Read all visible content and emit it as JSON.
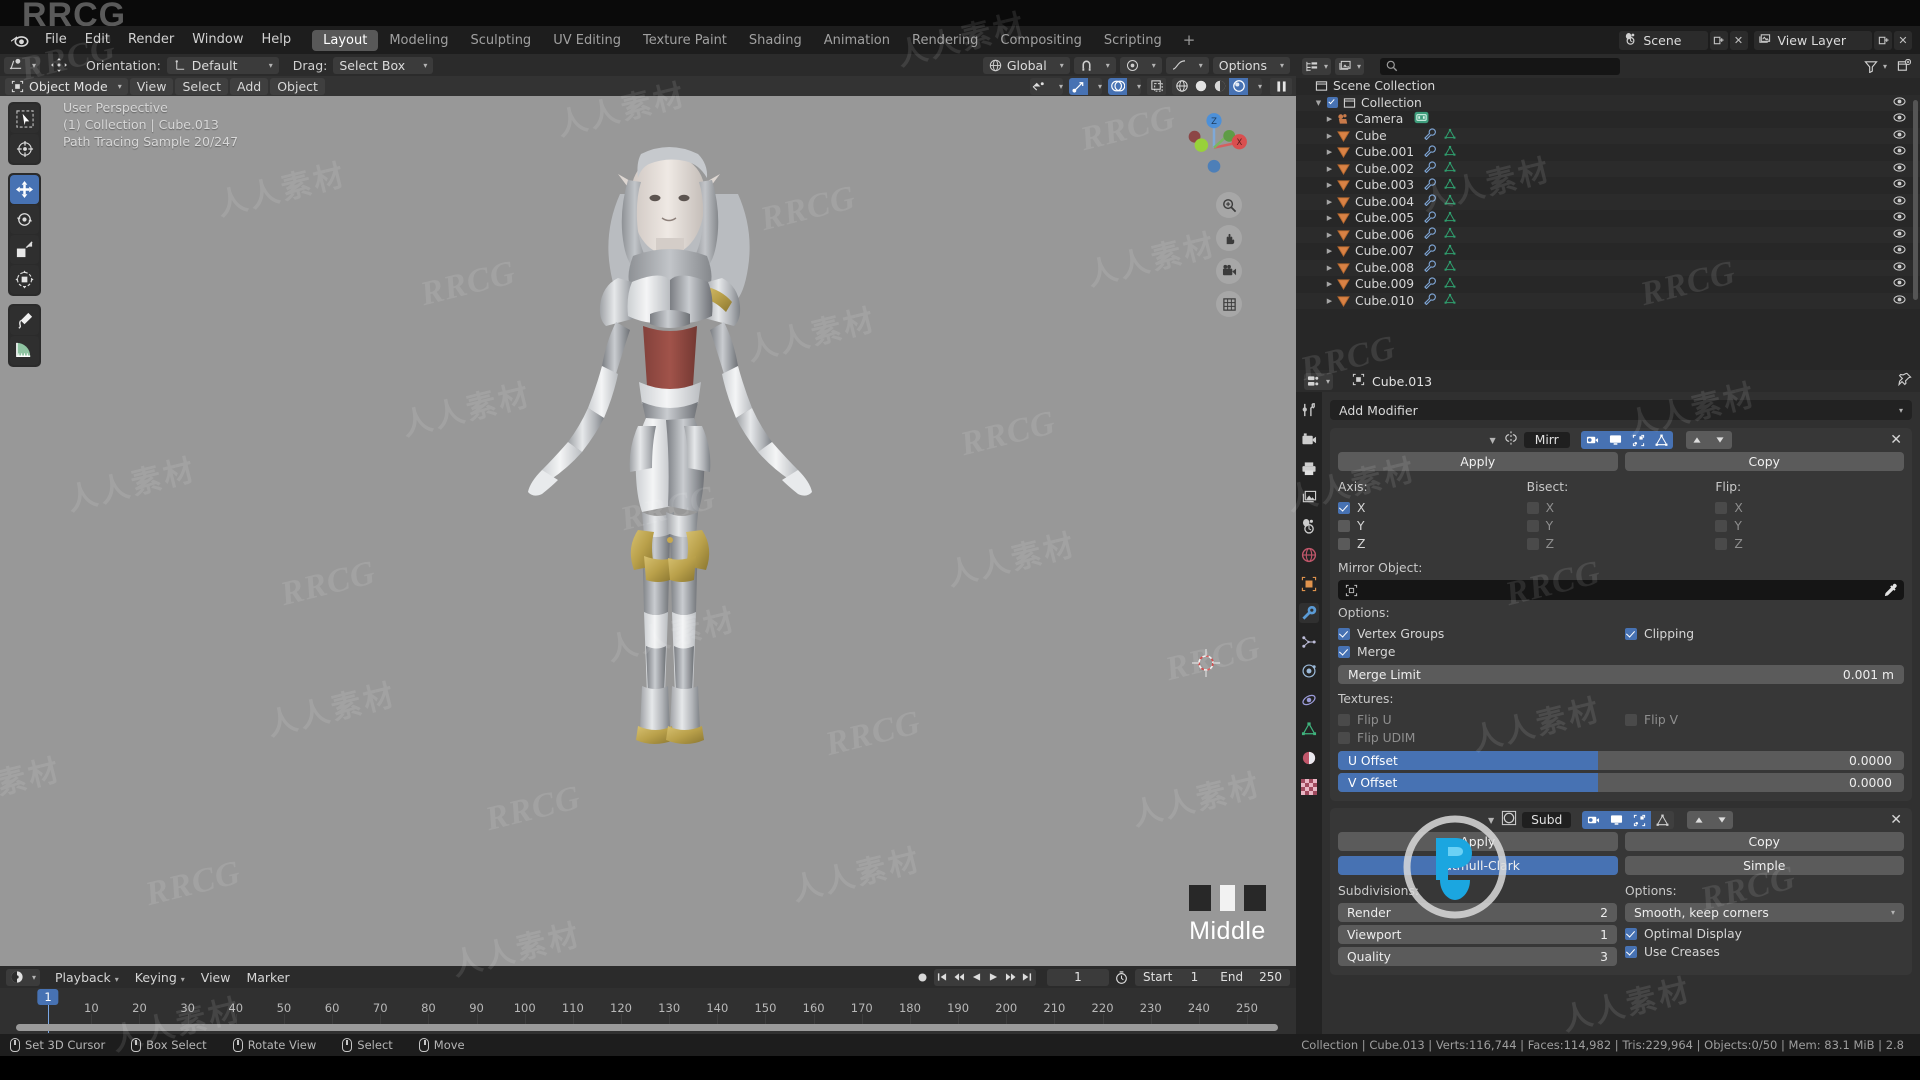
{
  "brand": {
    "watermark_en": "RRCG",
    "watermark_cn": "人人素材",
    "logo_text": "RRCG"
  },
  "topbar": {
    "menus": [
      "File",
      "Edit",
      "Render",
      "Window",
      "Help"
    ],
    "workspaces": [
      "Layout",
      "Modeling",
      "Sculpting",
      "UV Editing",
      "Texture Paint",
      "Shading",
      "Animation",
      "Rendering",
      "Compositing",
      "Scripting"
    ],
    "active_workspace": "Layout",
    "add_workspace": "+",
    "scene_name": "Scene",
    "view_layer_name": "View Layer",
    "scene_icon": "scene-icon",
    "viewlayer_icon": "images-icon"
  },
  "viewport_header": {
    "transform_pivot_icon": "pivot-icon",
    "snap_icon": "snap-magnet-icon",
    "orientation_label": "Orientation:",
    "orientation_value": "Default",
    "drag_label": "Drag:",
    "drag_value": "Select Box",
    "global_label": "Global",
    "snapping_icon": "magnet-icon",
    "proportional_icon": "proportional-edit-icon",
    "falloff_icon": "falloff-curve-icon",
    "options_label": "Options"
  },
  "mode_bar": {
    "mode": "Object Mode",
    "menus": [
      "View",
      "Select",
      "Add",
      "Object"
    ],
    "right_toggles": [
      "visibility-icon",
      "gizmo-icon",
      "overlays-icon",
      "xray-icon",
      "wireframe-shading",
      "solid-shading",
      "material-preview-shading",
      "rendered-shading",
      "pause-render-icon"
    ]
  },
  "viewport": {
    "overlay_lines": [
      "User Perspective",
      "(1) Collection | Cube.013",
      "Path Tracing Sample 20/247"
    ],
    "tools": [
      {
        "name": "tweak-select-tool",
        "active": false
      },
      {
        "name": "cursor-tool",
        "active": false
      },
      {
        "name": "move-tool",
        "active": true
      },
      {
        "name": "rotate-tool",
        "active": false
      },
      {
        "name": "scale-tool",
        "active": false
      },
      {
        "name": "transform-tool",
        "active": false
      },
      {
        "name": "annotate-tool",
        "active": false
      },
      {
        "name": "measure-tool",
        "active": false
      }
    ],
    "nav_buttons": [
      "zoom-icon",
      "pan-hand-icon",
      "camera-view-icon",
      "toggle-ortho-icon"
    ],
    "gizmo_axes": [
      "Z",
      "X"
    ],
    "middle_label": "Middle",
    "swatch_colors": [
      "#282828",
      "#f2f2f2",
      "#282828"
    ]
  },
  "outliner": {
    "display_mode_icon": "outliner-display-icon",
    "filter_icon": "filter-funnel-icon",
    "new_collection_icon": "new-collection-icon",
    "search_placeholder": "",
    "search_icon": "search-icon",
    "root": "Scene Collection",
    "rows": [
      {
        "label": "Scene Collection",
        "indent": 0,
        "icon": "collection-icon",
        "type": "scene",
        "eye": false,
        "tri": false,
        "check": false
      },
      {
        "label": "Collection",
        "indent": 1,
        "icon": "collection-icon",
        "type": "collection",
        "eye": true,
        "tri": true,
        "check": true
      },
      {
        "label": "Camera",
        "indent": 2,
        "icon": "camera-data-icon",
        "type": "camera",
        "eye": true,
        "tri": true,
        "check": false
      },
      {
        "label": "Cube",
        "indent": 2,
        "icon": "mesh-icon",
        "type": "mesh",
        "eye": true,
        "tri": true,
        "check": false
      },
      {
        "label": "Cube.001",
        "indent": 2,
        "icon": "mesh-icon",
        "type": "mesh",
        "eye": true,
        "tri": true,
        "check": false
      },
      {
        "label": "Cube.002",
        "indent": 2,
        "icon": "mesh-icon",
        "type": "mesh",
        "eye": true,
        "tri": true,
        "check": false
      },
      {
        "label": "Cube.003",
        "indent": 2,
        "icon": "mesh-icon",
        "type": "mesh",
        "eye": true,
        "tri": true,
        "check": false
      },
      {
        "label": "Cube.004",
        "indent": 2,
        "icon": "mesh-icon",
        "type": "mesh",
        "eye": true,
        "tri": true,
        "check": false
      },
      {
        "label": "Cube.005",
        "indent": 2,
        "icon": "mesh-icon",
        "type": "mesh",
        "eye": true,
        "tri": true,
        "check": false
      },
      {
        "label": "Cube.006",
        "indent": 2,
        "icon": "mesh-icon",
        "type": "mesh",
        "eye": true,
        "tri": true,
        "check": false
      },
      {
        "label": "Cube.007",
        "indent": 2,
        "icon": "mesh-icon",
        "type": "mesh",
        "eye": true,
        "tri": true,
        "check": false
      },
      {
        "label": "Cube.008",
        "indent": 2,
        "icon": "mesh-icon",
        "type": "mesh",
        "eye": true,
        "tri": true,
        "check": false
      },
      {
        "label": "Cube.009",
        "indent": 2,
        "icon": "mesh-icon",
        "type": "mesh",
        "eye": true,
        "tri": true,
        "check": false
      },
      {
        "label": "Cube.010",
        "indent": 2,
        "icon": "mesh-icon",
        "type": "mesh",
        "eye": true,
        "tri": true,
        "check": false
      }
    ]
  },
  "properties": {
    "breadcrumb_object": "Cube.013",
    "pin_icon": "pin-icon",
    "editor_type_icon": "properties-editor-icon",
    "tabs": [
      {
        "name": "tool-tab",
        "icon": "tool-icon",
        "active": false
      },
      {
        "name": "render-tab",
        "icon": "render-camera-icon",
        "active": false
      },
      {
        "name": "output-tab",
        "icon": "printer-icon",
        "active": false
      },
      {
        "name": "viewlayer-tab",
        "icon": "images-icon",
        "active": false
      },
      {
        "name": "scene-tab",
        "icon": "scene-cone-icon",
        "active": false
      },
      {
        "name": "world-tab",
        "icon": "world-globe-icon",
        "active": false
      },
      {
        "name": "object-tab",
        "icon": "object-square-icon",
        "active": false
      },
      {
        "name": "modifier-tab",
        "icon": "wrench-icon",
        "active": true
      },
      {
        "name": "particles-tab",
        "icon": "particles-icon",
        "active": false
      },
      {
        "name": "physics-tab",
        "icon": "physics-orbit-icon",
        "active": false
      },
      {
        "name": "constraints-tab",
        "icon": "constraint-icon",
        "active": false
      },
      {
        "name": "data-tab",
        "icon": "mesh-data-icon",
        "active": false
      },
      {
        "name": "material-tab",
        "icon": "material-sphere-icon",
        "active": false
      },
      {
        "name": "texture-tab",
        "icon": "checker-texture-icon",
        "active": false
      }
    ],
    "add_modifier_label": "Add Modifier",
    "modifiers": [
      {
        "type": "mirror",
        "name": "Mirr",
        "icon": "mirror-modifier-icon",
        "display_toggles": [
          {
            "name": "render-toggle",
            "on": true
          },
          {
            "name": "realtime-toggle",
            "on": true
          },
          {
            "name": "edit-mode-toggle",
            "on": true
          },
          {
            "name": "on-cage-toggle",
            "on": true
          }
        ],
        "apply_label": "Apply",
        "copy_label": "Copy",
        "axis_label": "Axis:",
        "bisect_label": "Bisect:",
        "flip_label": "Flip:",
        "axis": [
          {
            "label": "X",
            "on": true
          },
          {
            "label": "Y",
            "on": false
          },
          {
            "label": "Z",
            "on": false
          }
        ],
        "bisect": [
          {
            "label": "X",
            "on": false
          },
          {
            "label": "Y",
            "on": false
          },
          {
            "label": "Z",
            "on": false
          }
        ],
        "flip": [
          {
            "label": "X",
            "on": false
          },
          {
            "label": "Y",
            "on": false
          },
          {
            "label": "Z",
            "on": false
          }
        ],
        "mirror_object_label": "Mirror Object:",
        "mirror_object_value": "",
        "eyedropper_icon": "eyedropper-icon",
        "options_label": "Options:",
        "vertex_groups_label": "Vertex Groups",
        "vertex_groups_on": true,
        "clipping_label": "Clipping",
        "clipping_on": true,
        "merge_label": "Merge",
        "merge_on": true,
        "merge_limit_label": "Merge Limit",
        "merge_limit_value": "0.001 m",
        "textures_label": "Textures:",
        "flip_u_label": "Flip U",
        "flip_u_on": false,
        "flip_v_label": "Flip V",
        "flip_v_on": false,
        "flip_udim_label": "Flip UDIM",
        "flip_udim_on": false,
        "u_offset_label": "U Offset",
        "u_offset_value": "0.0000",
        "v_offset_label": "V Offset",
        "v_offset_value": "0.0000"
      },
      {
        "type": "subsurf",
        "name": "Subd",
        "icon": "subdivision-modifier-icon",
        "display_toggles": [
          {
            "name": "render-toggle",
            "on": true
          },
          {
            "name": "realtime-toggle",
            "on": true
          },
          {
            "name": "edit-mode-toggle",
            "on": true
          },
          {
            "name": "on-cage-toggle",
            "on": false
          }
        ],
        "apply_label": "Apply",
        "copy_label": "Copy",
        "catmull_label": "Catmull-Clark",
        "catmull_active": true,
        "simple_label": "Simple",
        "subdivisions_label": "Subdivisions:",
        "options_label": "Options:",
        "render_label": "Render",
        "render_value": "2",
        "viewport_label": "Viewport",
        "viewport_value": "1",
        "quality_label": "Quality",
        "quality_value": "3",
        "uv_smooth_value": "Smooth, keep corners",
        "optimal_display_label": "Optimal Display",
        "optimal_display_on": true,
        "use_creases_label": "Use Creases",
        "use_creases_on": true
      }
    ]
  },
  "timeline": {
    "editor_icon": "timeline-editor-icon",
    "menus": [
      "Playback",
      "Keying",
      "View",
      "Marker"
    ],
    "transport": [
      "record-icon",
      "jump-start-icon",
      "prev-keyframe-icon",
      "play-reverse-icon",
      "play-icon",
      "next-keyframe-icon",
      "jump-end-icon"
    ],
    "current_frame": "1",
    "auto_key_icon": "auto-keying-icon",
    "start_label": "Start",
    "start_value": "1",
    "end_label": "End",
    "end_value": "250",
    "ticks": [
      10,
      20,
      30,
      40,
      50,
      60,
      70,
      80,
      90,
      100,
      110,
      120,
      130,
      140,
      150,
      160,
      170,
      180,
      190,
      200,
      210,
      220,
      230,
      240,
      250
    ],
    "playhead_frame": "1"
  },
  "statusbar": {
    "hints": [
      {
        "mouse": "left",
        "label": "Set 3D Cursor"
      },
      {
        "mouse": "left-drag",
        "label": "Box Select"
      },
      {
        "mouse": "middle",
        "label": "Rotate View"
      },
      {
        "mouse": "left",
        "label": "Select"
      },
      {
        "mouse": "right",
        "label": "Move"
      }
    ],
    "scene_stats": "Collection | Cube.013 | Verts:116,744 | Faces:114,982 | Tris:229,964 | Objects:0/50 | Mem: 83.1 MiB | 2.8"
  },
  "colors": {
    "accent_blue": "#4772b3",
    "viewport_bg": "#989898",
    "panel_bg": "#303030",
    "header_bg": "#2b2b2b",
    "outliner_bg": "#272727",
    "mesh_orange": "#e0824a",
    "mesh_data_green": "#33b07a"
  }
}
